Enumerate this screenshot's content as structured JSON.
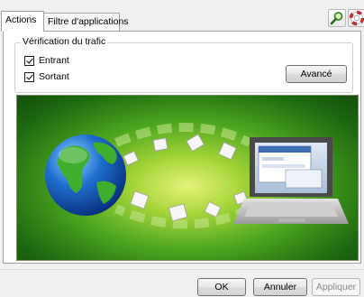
{
  "tabs": [
    {
      "label": "Actions",
      "active": true
    },
    {
      "label": "Filtre d'applications",
      "active": false
    }
  ],
  "toolbar": {
    "search_icon": "search-magnifier-icon",
    "help_icon": "lifebuoy-help-icon"
  },
  "traffic": {
    "group_title": "Vérification du trafic",
    "inbound": {
      "label": "Entrant",
      "checked": true
    },
    "outbound": {
      "label": "Sortant",
      "checked": true
    },
    "advanced_button": "Avancé"
  },
  "illustration": {
    "description_icons": [
      "globe-icon",
      "document-icon",
      "laptop-icon"
    ]
  },
  "footer": {
    "ok": "OK",
    "cancel": "Annuler",
    "apply": "Appliquer",
    "apply_enabled": false
  }
}
